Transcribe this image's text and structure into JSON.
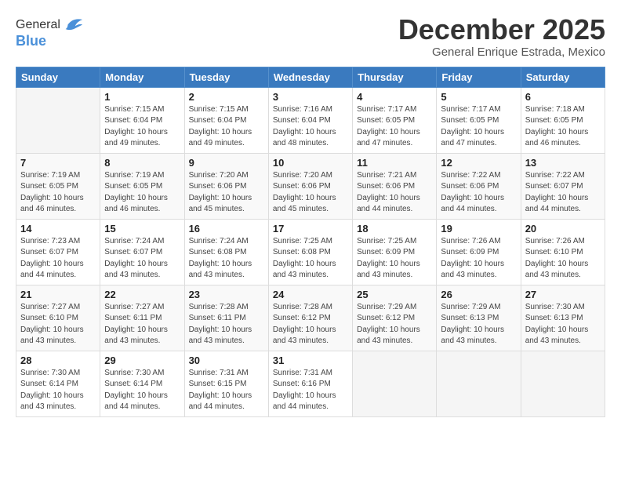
{
  "logo": {
    "general": "General",
    "blue": "Blue"
  },
  "title": "December 2025",
  "subtitle": "General Enrique Estrada, Mexico",
  "days_header": [
    "Sunday",
    "Monday",
    "Tuesday",
    "Wednesday",
    "Thursday",
    "Friday",
    "Saturday"
  ],
  "weeks": [
    [
      {
        "day": "",
        "info": ""
      },
      {
        "day": "1",
        "info": "Sunrise: 7:15 AM\nSunset: 6:04 PM\nDaylight: 10 hours\nand 49 minutes."
      },
      {
        "day": "2",
        "info": "Sunrise: 7:15 AM\nSunset: 6:04 PM\nDaylight: 10 hours\nand 49 minutes."
      },
      {
        "day": "3",
        "info": "Sunrise: 7:16 AM\nSunset: 6:04 PM\nDaylight: 10 hours\nand 48 minutes."
      },
      {
        "day": "4",
        "info": "Sunrise: 7:17 AM\nSunset: 6:05 PM\nDaylight: 10 hours\nand 47 minutes."
      },
      {
        "day": "5",
        "info": "Sunrise: 7:17 AM\nSunset: 6:05 PM\nDaylight: 10 hours\nand 47 minutes."
      },
      {
        "day": "6",
        "info": "Sunrise: 7:18 AM\nSunset: 6:05 PM\nDaylight: 10 hours\nand 46 minutes."
      }
    ],
    [
      {
        "day": "7",
        "info": "Sunrise: 7:19 AM\nSunset: 6:05 PM\nDaylight: 10 hours\nand 46 minutes."
      },
      {
        "day": "8",
        "info": "Sunrise: 7:19 AM\nSunset: 6:05 PM\nDaylight: 10 hours\nand 46 minutes."
      },
      {
        "day": "9",
        "info": "Sunrise: 7:20 AM\nSunset: 6:06 PM\nDaylight: 10 hours\nand 45 minutes."
      },
      {
        "day": "10",
        "info": "Sunrise: 7:20 AM\nSunset: 6:06 PM\nDaylight: 10 hours\nand 45 minutes."
      },
      {
        "day": "11",
        "info": "Sunrise: 7:21 AM\nSunset: 6:06 PM\nDaylight: 10 hours\nand 44 minutes."
      },
      {
        "day": "12",
        "info": "Sunrise: 7:22 AM\nSunset: 6:06 PM\nDaylight: 10 hours\nand 44 minutes."
      },
      {
        "day": "13",
        "info": "Sunrise: 7:22 AM\nSunset: 6:07 PM\nDaylight: 10 hours\nand 44 minutes."
      }
    ],
    [
      {
        "day": "14",
        "info": "Sunrise: 7:23 AM\nSunset: 6:07 PM\nDaylight: 10 hours\nand 44 minutes."
      },
      {
        "day": "15",
        "info": "Sunrise: 7:24 AM\nSunset: 6:07 PM\nDaylight: 10 hours\nand 43 minutes."
      },
      {
        "day": "16",
        "info": "Sunrise: 7:24 AM\nSunset: 6:08 PM\nDaylight: 10 hours\nand 43 minutes."
      },
      {
        "day": "17",
        "info": "Sunrise: 7:25 AM\nSunset: 6:08 PM\nDaylight: 10 hours\nand 43 minutes."
      },
      {
        "day": "18",
        "info": "Sunrise: 7:25 AM\nSunset: 6:09 PM\nDaylight: 10 hours\nand 43 minutes."
      },
      {
        "day": "19",
        "info": "Sunrise: 7:26 AM\nSunset: 6:09 PM\nDaylight: 10 hours\nand 43 minutes."
      },
      {
        "day": "20",
        "info": "Sunrise: 7:26 AM\nSunset: 6:10 PM\nDaylight: 10 hours\nand 43 minutes."
      }
    ],
    [
      {
        "day": "21",
        "info": "Sunrise: 7:27 AM\nSunset: 6:10 PM\nDaylight: 10 hours\nand 43 minutes."
      },
      {
        "day": "22",
        "info": "Sunrise: 7:27 AM\nSunset: 6:11 PM\nDaylight: 10 hours\nand 43 minutes."
      },
      {
        "day": "23",
        "info": "Sunrise: 7:28 AM\nSunset: 6:11 PM\nDaylight: 10 hours\nand 43 minutes."
      },
      {
        "day": "24",
        "info": "Sunrise: 7:28 AM\nSunset: 6:12 PM\nDaylight: 10 hours\nand 43 minutes."
      },
      {
        "day": "25",
        "info": "Sunrise: 7:29 AM\nSunset: 6:12 PM\nDaylight: 10 hours\nand 43 minutes."
      },
      {
        "day": "26",
        "info": "Sunrise: 7:29 AM\nSunset: 6:13 PM\nDaylight: 10 hours\nand 43 minutes."
      },
      {
        "day": "27",
        "info": "Sunrise: 7:30 AM\nSunset: 6:13 PM\nDaylight: 10 hours\nand 43 minutes."
      }
    ],
    [
      {
        "day": "28",
        "info": "Sunrise: 7:30 AM\nSunset: 6:14 PM\nDaylight: 10 hours\nand 43 minutes."
      },
      {
        "day": "29",
        "info": "Sunrise: 7:30 AM\nSunset: 6:14 PM\nDaylight: 10 hours\nand 44 minutes."
      },
      {
        "day": "30",
        "info": "Sunrise: 7:31 AM\nSunset: 6:15 PM\nDaylight: 10 hours\nand 44 minutes."
      },
      {
        "day": "31",
        "info": "Sunrise: 7:31 AM\nSunset: 6:16 PM\nDaylight: 10 hours\nand 44 minutes."
      },
      {
        "day": "",
        "info": ""
      },
      {
        "day": "",
        "info": ""
      },
      {
        "day": "",
        "info": ""
      }
    ]
  ]
}
